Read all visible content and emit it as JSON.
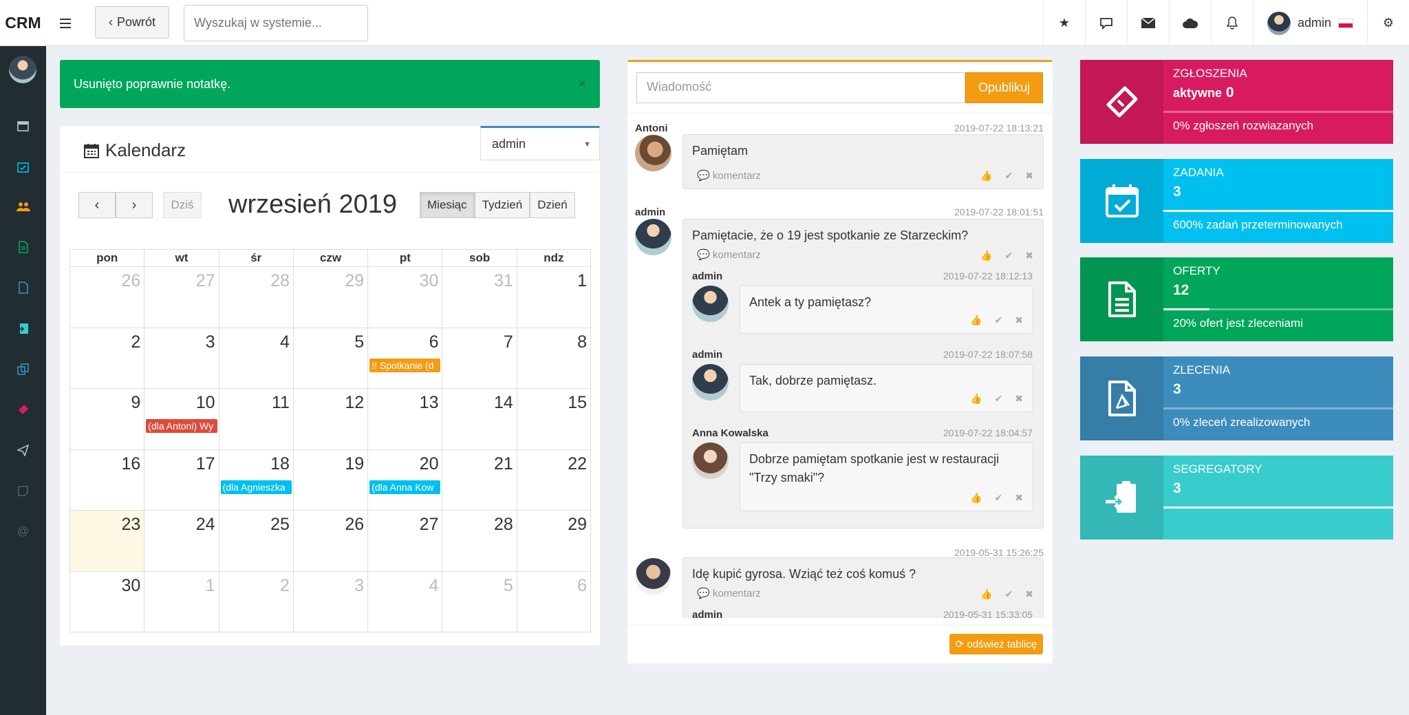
{
  "app": {
    "logo": "CRM"
  },
  "topbar": {
    "back_label": "Powrót",
    "search_placeholder": "Wyszukaj w systemie...",
    "user_name": "admin"
  },
  "alert": {
    "message": "Usunięto poprawnie notatkę."
  },
  "calendar": {
    "title": "Kalendarz",
    "user_select": "admin",
    "today_label": "Dziś",
    "month_label": "wrzesień 2019",
    "views": [
      "Miesiąc",
      "Tydzień",
      "Dzień"
    ],
    "active_view": "Miesiąc",
    "day_headers": [
      "pon",
      "wt",
      "śr",
      "czw",
      "pt",
      "sob",
      "ndz"
    ],
    "weeks": [
      [
        {
          "d": "26",
          "o": true
        },
        {
          "d": "27",
          "o": true
        },
        {
          "d": "28",
          "o": true
        },
        {
          "d": "29",
          "o": true
        },
        {
          "d": "30",
          "o": true
        },
        {
          "d": "31",
          "o": true
        },
        {
          "d": "1"
        }
      ],
      [
        {
          "d": "2"
        },
        {
          "d": "3"
        },
        {
          "d": "4"
        },
        {
          "d": "5"
        },
        {
          "d": "6",
          "ev": "!! Spotkanie (d",
          "evc": "#f39c12"
        },
        {
          "d": "7"
        },
        {
          "d": "8"
        }
      ],
      [
        {
          "d": "9"
        },
        {
          "d": "10",
          "ev": "(dla Antoni) Wy",
          "evc": "#dd4b39"
        },
        {
          "d": "11"
        },
        {
          "d": "12"
        },
        {
          "d": "13"
        },
        {
          "d": "14"
        },
        {
          "d": "15"
        }
      ],
      [
        {
          "d": "16"
        },
        {
          "d": "17"
        },
        {
          "d": "18",
          "ev": "(dla Agnieszka",
          "evc": "#00c0ef"
        },
        {
          "d": "19"
        },
        {
          "d": "20",
          "ev": "(dla Anna Kow",
          "evc": "#00c0ef"
        },
        {
          "d": "21"
        },
        {
          "d": "22"
        }
      ],
      [
        {
          "d": "23",
          "today": true
        },
        {
          "d": "24"
        },
        {
          "d": "25"
        },
        {
          "d": "26"
        },
        {
          "d": "27"
        },
        {
          "d": "28"
        },
        {
          "d": "29"
        }
      ],
      [
        {
          "d": "30"
        },
        {
          "d": "1",
          "o": true
        },
        {
          "d": "2",
          "o": true
        },
        {
          "d": "3",
          "o": true
        },
        {
          "d": "4",
          "o": true
        },
        {
          "d": "5",
          "o": true
        },
        {
          "d": "6",
          "o": true
        }
      ]
    ]
  },
  "chat": {
    "input_placeholder": "Wiadomość",
    "publish_label": "Opublikuj",
    "comment_label": "komentarz",
    "refresh_label": "odśwież tablicę",
    "messages": [
      {
        "author": "Antoni",
        "time": "2019-07-22 18:13:21",
        "text": "Pamiętam"
      },
      {
        "author": "admin",
        "time": "2019-07-22 18:01:51",
        "text": "Pamiętacie, że o 19 jest spotkanie ze Starzeckim?"
      },
      {
        "author": "admin",
        "time": "2019-07-22 18:12:13",
        "text": "Antek a ty pamiętasz?"
      },
      {
        "author": "admin",
        "time": "2019-07-22 18:07:58",
        "text": "Tak, dobrze pamiętasz."
      },
      {
        "author": "Anna Kowalska",
        "time": "2019-07-22 18:04:57",
        "text": "Dobrze pamiętam spotkanie jest w restauracji \"Trzy smaki\"?"
      },
      {
        "author": "",
        "time": "2019-05-31 15:26:25",
        "text": "Idę kupić gyrosa. Wziąć też coś komuś ?"
      },
      {
        "author": "admin",
        "time": "2019-05-31 15:33:05",
        "text": ""
      }
    ]
  },
  "infoboxes": [
    {
      "title": "ZGŁOSZENIA",
      "prefix": "aktywne",
      "value": "0",
      "desc": "0% zgłoszeń rozwiazanych",
      "color": "#d81b60",
      "progress": 0,
      "icon": "ticket-icon"
    },
    {
      "title": "ZADANIA",
      "prefix": "",
      "value": "3",
      "desc": "600% zadań przeterminowanych",
      "color": "#00c0ef",
      "progress": 100,
      "icon": "calendar-check-icon"
    },
    {
      "title": "OFERTY",
      "prefix": "",
      "value": "12",
      "desc": "20% ofert jest zleceniami",
      "color": "#00a65a",
      "progress": 20,
      "icon": "document-icon"
    },
    {
      "title": "ZLECENIA",
      "prefix": "",
      "value": "3",
      "desc": "0% zleceń zrealizowanych",
      "color": "#3c8dbc",
      "progress": 0,
      "icon": "pdf-icon"
    },
    {
      "title": "SEGREGATORY",
      "prefix": "",
      "value": "3",
      "desc": "",
      "color": "#39cccc",
      "progress": 100,
      "icon": "clipboard-icon"
    }
  ]
}
